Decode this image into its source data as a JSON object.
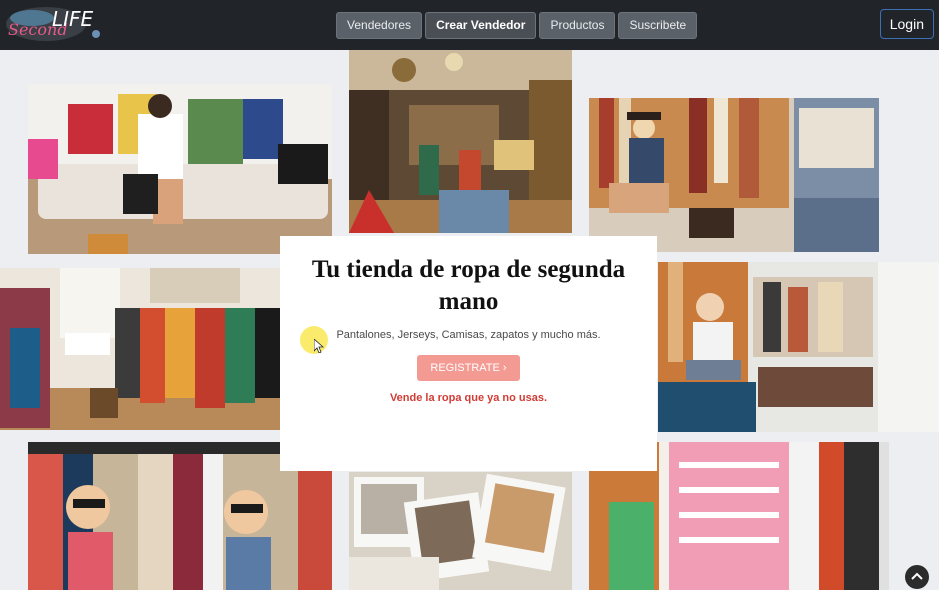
{
  "brand": {
    "logo_script": "Second",
    "logo_word": "LIFE"
  },
  "nav": {
    "items": [
      {
        "label": "Vendedores",
        "active": false
      },
      {
        "label": "Crear Vendedor",
        "active": true
      },
      {
        "label": "Productos",
        "active": false
      },
      {
        "label": "Suscribete",
        "active": false
      }
    ],
    "login_label": "Login"
  },
  "hero": {
    "title": "Tu tienda de ropa de segunda mano",
    "subtitle": "Pantalones, Jerseys, Camisas, zapatos y mucho más.",
    "cta_label": "REGISTRATE ›",
    "tagline": "Vende la ropa que ya no usas."
  },
  "colors": {
    "navbar": "#212529",
    "nav_button": "#5b6168",
    "cta": "#f39a93",
    "tagline": "#d13c35",
    "login_border": "#3d6fb5"
  },
  "icons": {
    "cursor": "pointer-cursor-icon",
    "scroll_top": "chevron-up-icon"
  }
}
